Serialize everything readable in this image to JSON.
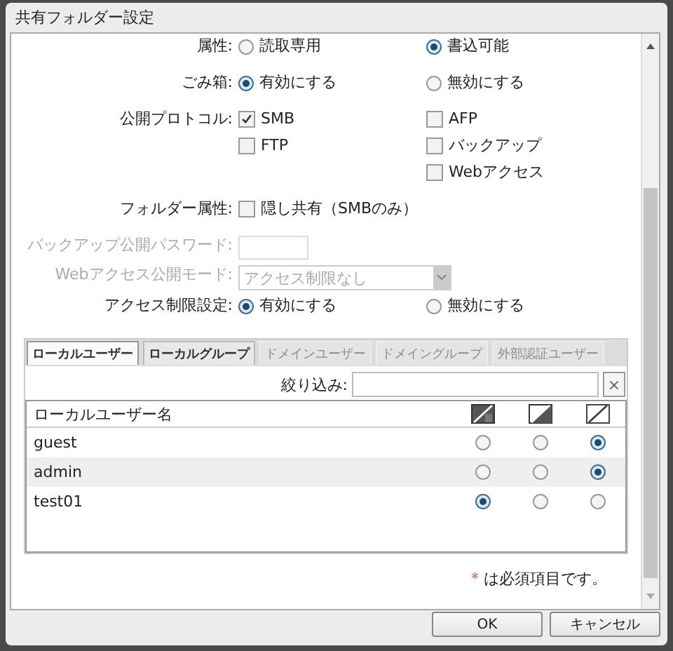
{
  "window": {
    "title": "共有フォルダー設定"
  },
  "form": [
    {
      "label": "属性:",
      "kind": "radio",
      "disabled": false,
      "columns": [
        [
          {
            "label": "読取専用",
            "selected": false
          }
        ],
        [
          {
            "label": "書込可能",
            "selected": true
          }
        ]
      ]
    },
    {
      "label": "ごみ箱:",
      "kind": "radio",
      "disabled": false,
      "columns": [
        [
          {
            "label": "有効にする",
            "selected": true
          }
        ],
        [
          {
            "label": "無効にする",
            "selected": false
          }
        ]
      ]
    },
    {
      "label": "公開プロトコル:",
      "kind": "checkbox",
      "disabled": false,
      "columns": [
        [
          {
            "label": "SMB",
            "checked": true
          },
          {
            "label": "FTP",
            "checked": false
          }
        ],
        [
          {
            "label": "AFP",
            "checked": false
          },
          {
            "label": "バックアップ",
            "checked": false
          },
          {
            "label": "Webアクセス",
            "checked": false
          }
        ]
      ]
    },
    {
      "label": "フォルダー属性:",
      "kind": "checkbox",
      "disabled": false,
      "columns": [
        [
          {
            "label": "隠し共有（SMBのみ）",
            "checked": false
          }
        ]
      ]
    },
    {
      "label": "バックアップ公開パスワード:",
      "kind": "password",
      "disabled": true
    },
    {
      "label": "Webアクセス公開モード:",
      "kind": "select",
      "disabled": true,
      "value": "アクセス制限なし"
    },
    {
      "label": "アクセス制限設定:",
      "kind": "radio",
      "disabled": false,
      "columns": [
        [
          {
            "label": "有効にする",
            "selected": true
          }
        ],
        [
          {
            "label": "無効にする",
            "selected": false
          }
        ]
      ]
    }
  ],
  "tabs": [
    {
      "label": "ローカルユーザー",
      "selected": true,
      "disabled": false
    },
    {
      "label": "ローカルグループ",
      "selected": false,
      "disabled": false
    },
    {
      "label": "ドメインユーザー",
      "selected": false,
      "disabled": true
    },
    {
      "label": "ドメイングループ",
      "selected": false,
      "disabled": true
    },
    {
      "label": "外部認証ユーザー",
      "selected": false,
      "disabled": true
    }
  ],
  "filter": {
    "label": "絞り込み:",
    "clear": "×"
  },
  "table": {
    "column_header": "ローカルユーザー名",
    "rows": [
      {
        "name": "guest",
        "access": [
          {
            "selected": false
          },
          {
            "selected": false
          },
          {
            "selected": true
          }
        ]
      },
      {
        "name": "admin",
        "access": [
          {
            "selected": false
          },
          {
            "selected": false
          },
          {
            "selected": true
          }
        ]
      },
      {
        "name": "test01",
        "access": [
          {
            "selected": true
          },
          {
            "selected": false
          },
          {
            "selected": false
          }
        ]
      }
    ]
  },
  "required_note": {
    "mark": "*",
    "text": "は必須項目です。"
  },
  "buttons": [
    "OK",
    "キャンセル"
  ]
}
